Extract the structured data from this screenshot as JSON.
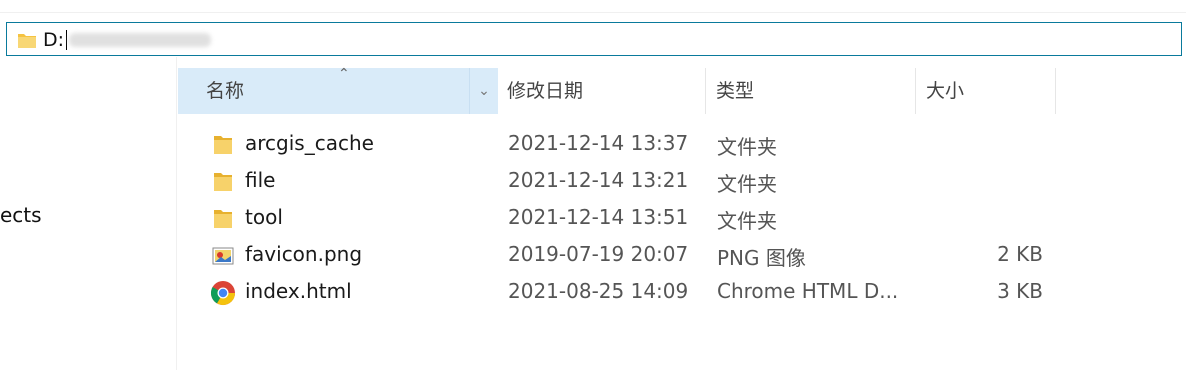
{
  "address": {
    "text": "D:"
  },
  "nav": {
    "partial_item": "ects"
  },
  "columns": {
    "name": "名称",
    "date": "修改日期",
    "type": "类型",
    "size": "大小"
  },
  "rows": [
    {
      "name": "arcgis_cache",
      "date": "2021-12-14 13:37",
      "type": "文件夹",
      "size": "",
      "icon": "folder-icon"
    },
    {
      "name": "file",
      "date": "2021-12-14 13:21",
      "type": "文件夹",
      "size": "",
      "icon": "folder-icon"
    },
    {
      "name": "tool",
      "date": "2021-12-14 13:51",
      "type": "文件夹",
      "size": "",
      "icon": "folder-icon"
    },
    {
      "name": "favicon.png",
      "date": "2019-07-19 20:07",
      "type": "PNG 图像",
      "size": "2 KB",
      "icon": "image-file-icon"
    },
    {
      "name": "index.html",
      "date": "2021-08-25 14:09",
      "type": "Chrome HTML D...",
      "size": "3 KB",
      "icon": "chrome-icon"
    }
  ],
  "colors": {
    "header_selected_bg": "#d9ebf9",
    "address_border": "#0a7a9c",
    "folder_yellow": "#f5c341"
  }
}
